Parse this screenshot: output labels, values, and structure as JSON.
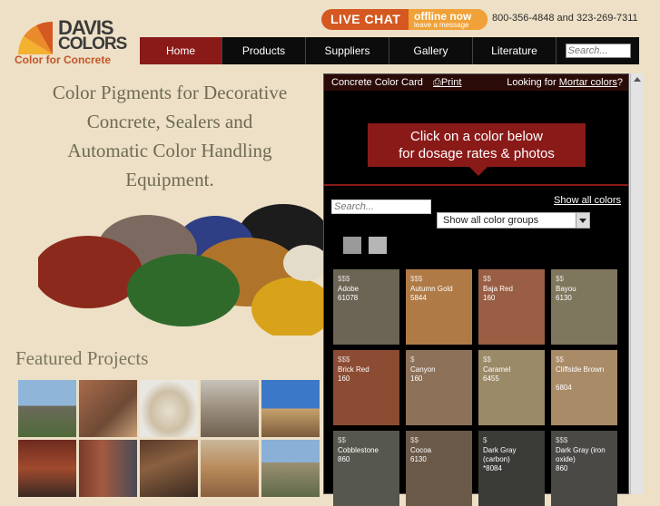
{
  "logo": {
    "line1": "DAVIS",
    "line2": "COLORS",
    "tagline": "Color for Concrete"
  },
  "chat": {
    "live": "LIVE CHAT",
    "offline": "offline now",
    "leave": "leave a message"
  },
  "phone": "800-356-4848 and 323-269-7311",
  "nav": [
    "Home",
    "Products",
    "Suppliers",
    "Gallery",
    "Literature"
  ],
  "nav_search_placeholder": "Search...",
  "headline": [
    "Color Pigments for Decorative",
    "Concrete, Sealers and",
    "Automatic Color Handling",
    "Equipment."
  ],
  "featured": "Featured Projects",
  "card": {
    "title": "Concrete Color Card",
    "print": "Print",
    "looking": "Looking for ",
    "mortar": "Mortar colors",
    "qmark": "?",
    "cta_line1": "Click on a color below",
    "cta_line2": "for dosage rates & photos",
    "search_placeholder": "Search...",
    "show_all": "Show all colors",
    "group_select": "Show all color groups",
    "tiles": [
      {
        "price": "$$$",
        "name": "Adobe",
        "code": "61078",
        "color": "#6c6454"
      },
      {
        "price": "$$$",
        "name": "Autumn Gold",
        "code": "5844",
        "color": "#b07a46"
      },
      {
        "price": "$$",
        "name": "Baja Red",
        "code": "160",
        "color": "#995e44"
      },
      {
        "price": "$$",
        "name": "Bayou",
        "code": "6130",
        "color": "#7e765d"
      },
      {
        "price": "$$$",
        "name": "Brick Red",
        "code": "160",
        "color": "#8c4c33"
      },
      {
        "price": "$",
        "name": "Canyon",
        "code": "160",
        "color": "#8d7158"
      },
      {
        "price": "$$",
        "name": "Caramel",
        "code": "6455",
        "color": "#9b8a68"
      },
      {
        "price": "$$",
        "name": "Cliffside Brown",
        "code": "6804",
        "color": "#a98b67"
      },
      {
        "price": "$$",
        "name": "Cobblestone",
        "code": "860",
        "color": "#56574f"
      },
      {
        "price": "$$",
        "name": "Cocoa",
        "code": "6130",
        "color": "#6b5a4a"
      },
      {
        "price": "$",
        "name": "Dark Gray (carbon)",
        "code": "*8084",
        "color": "#3b3b38"
      },
      {
        "price": "$$$",
        "name": "Dark Gray (iron oxide)",
        "code": "860",
        "color": "#4a4945"
      }
    ]
  }
}
